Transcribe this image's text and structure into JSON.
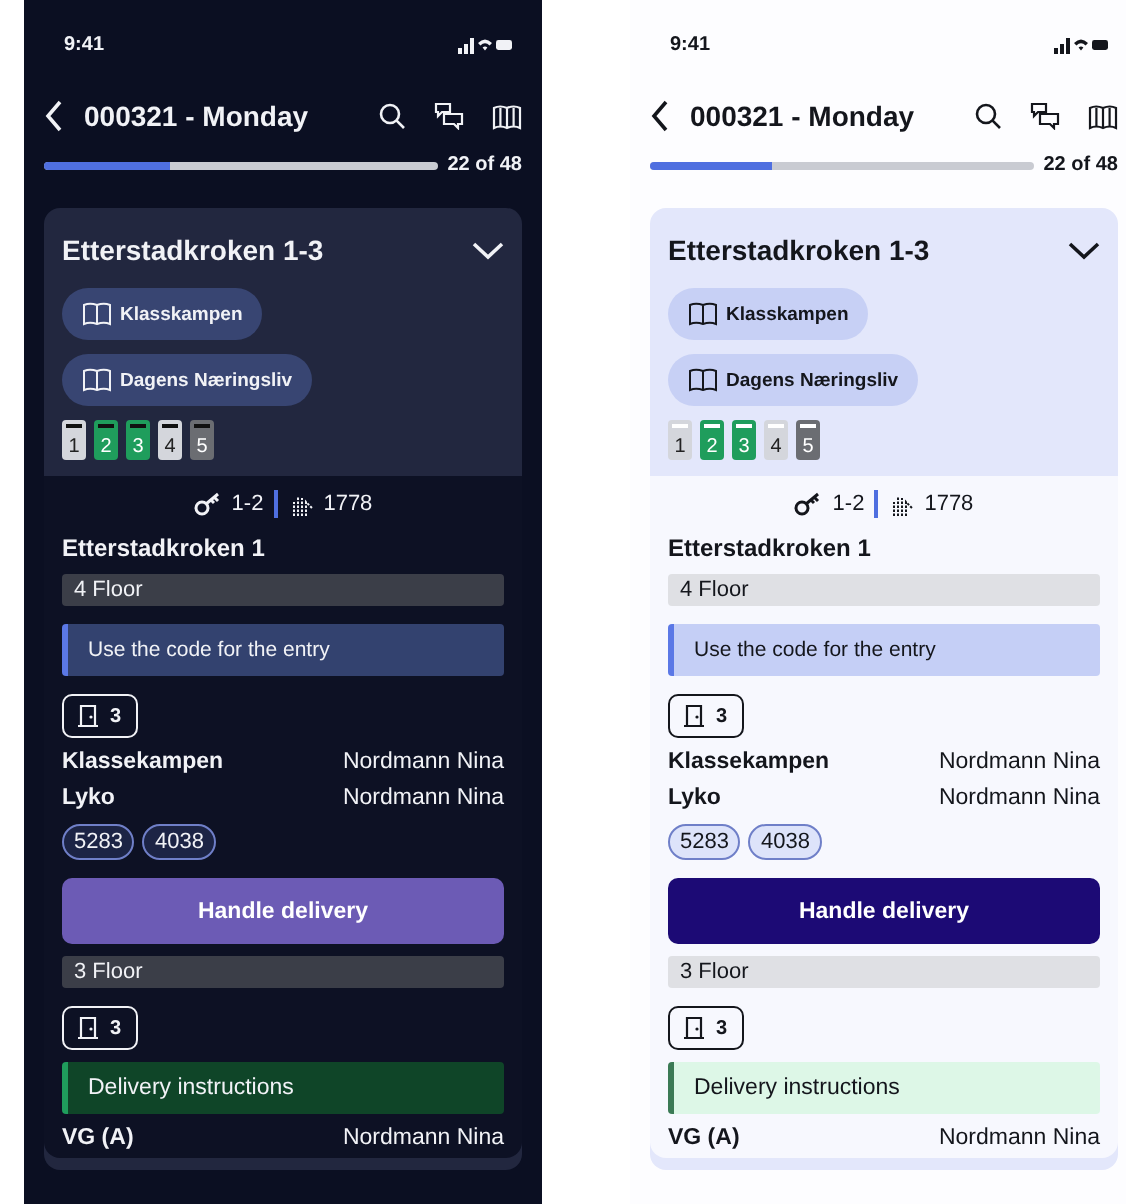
{
  "screens": [
    {
      "kind": "dark",
      "status_bar": {
        "time": "9:41"
      },
      "header": {
        "title": "000321 - Monday"
      },
      "progress": {
        "level": 0.32,
        "label": "22 of 48"
      },
      "stop": {
        "title": "Etterstadkroken 1-3",
        "expanded": true,
        "publications": [
          "Klasskampen",
          "Dagens Næringsliv"
        ],
        "mailboxes": [
          {
            "label": "1",
            "color": "#d4d6dc"
          },
          {
            "label": "2",
            "color": "#1f9d5c"
          },
          {
            "label": "3",
            "color": "#1f9d5c"
          },
          {
            "label": "4",
            "color": "#d4d6dc"
          },
          {
            "label": "5",
            "color": "#6b6d72"
          }
        ],
        "keys": "1-2",
        "code": "1778",
        "address": "Etterstadkroken 1",
        "items": [
          {
            "kind": "floor",
            "text": "4 Floor"
          },
          {
            "kind": "info",
            "text": "Use the code for the entry"
          },
          {
            "kind": "door",
            "text": "3"
          },
          {
            "kind": "delivery",
            "product": "Klassekampen",
            "recipient": "Nordmann Nina"
          },
          {
            "kind": "delivery",
            "product": "Lyko",
            "recipient": "Nordmann Nina"
          },
          {
            "kind": "codes",
            "codes": [
              "5283",
              "4038"
            ]
          },
          {
            "kind": "action",
            "text": "Handle delivery"
          },
          {
            "kind": "floor",
            "text": "3 Floor"
          },
          {
            "kind": "door",
            "text": "3"
          },
          {
            "kind": "instructions",
            "text": "Delivery instructions"
          },
          {
            "kind": "delivery",
            "product": "VG (A)",
            "recipient": "Nordmann Nina"
          }
        ]
      }
    },
    {
      "kind": "light",
      "status_bar": {
        "time": "9:41"
      },
      "header": {
        "title": "000321 - Monday"
      },
      "progress": {
        "level": 0.32,
        "label": "22 of 48"
      },
      "stop": {
        "title": "Etterstadkroken 1-3",
        "expanded": true,
        "publications": [
          "Klasskampen",
          "Dagens Næringsliv"
        ],
        "mailboxes": [
          {
            "label": "1",
            "color": "#d4d6dc"
          },
          {
            "label": "2",
            "color": "#1f9d5c"
          },
          {
            "label": "3",
            "color": "#1f9d5c"
          },
          {
            "label": "4",
            "color": "#d4d6dc"
          },
          {
            "label": "5",
            "color": "#6b6d72"
          }
        ],
        "keys": "1-2",
        "code": "1778",
        "address": "Etterstadkroken 1",
        "items": [
          {
            "kind": "floor",
            "text": "4 Floor"
          },
          {
            "kind": "info",
            "text": "Use the code for the entry"
          },
          {
            "kind": "door",
            "text": "3"
          },
          {
            "kind": "delivery",
            "product": "Klassekampen",
            "recipient": "Nordmann Nina"
          },
          {
            "kind": "delivery",
            "product": "Lyko",
            "recipient": "Nordmann Nina"
          },
          {
            "kind": "codes",
            "codes": [
              "5283",
              "4038"
            ]
          },
          {
            "kind": "action",
            "text": "Handle delivery"
          },
          {
            "kind": "floor",
            "text": "3 Floor"
          },
          {
            "kind": "door",
            "text": "3"
          },
          {
            "kind": "instructions",
            "text": "Delivery instructions"
          },
          {
            "kind": "delivery",
            "product": "VG (A)",
            "recipient": "Nordmann Nina"
          }
        ]
      }
    }
  ]
}
